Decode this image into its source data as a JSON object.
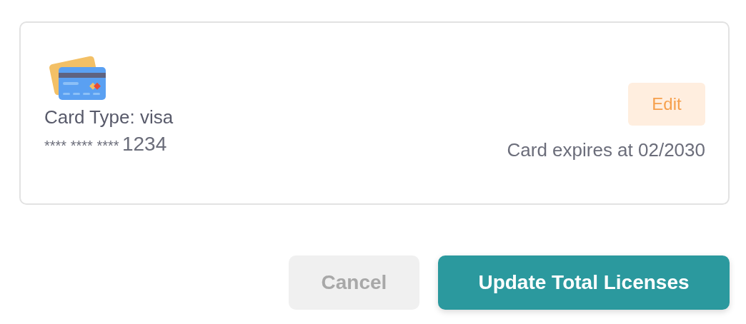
{
  "payment_card": {
    "card_type": "Card Type: visa",
    "number_mask": "**** **** ****",
    "number_last": "1234",
    "edit_button": "Edit",
    "expiry": "Card expires at 02/2030"
  },
  "buttons": [
    {
      "kind": "secondary",
      "label": "Cancel"
    },
    {
      "kind": "primary",
      "label": "Update Total Licenses"
    }
  ]
}
